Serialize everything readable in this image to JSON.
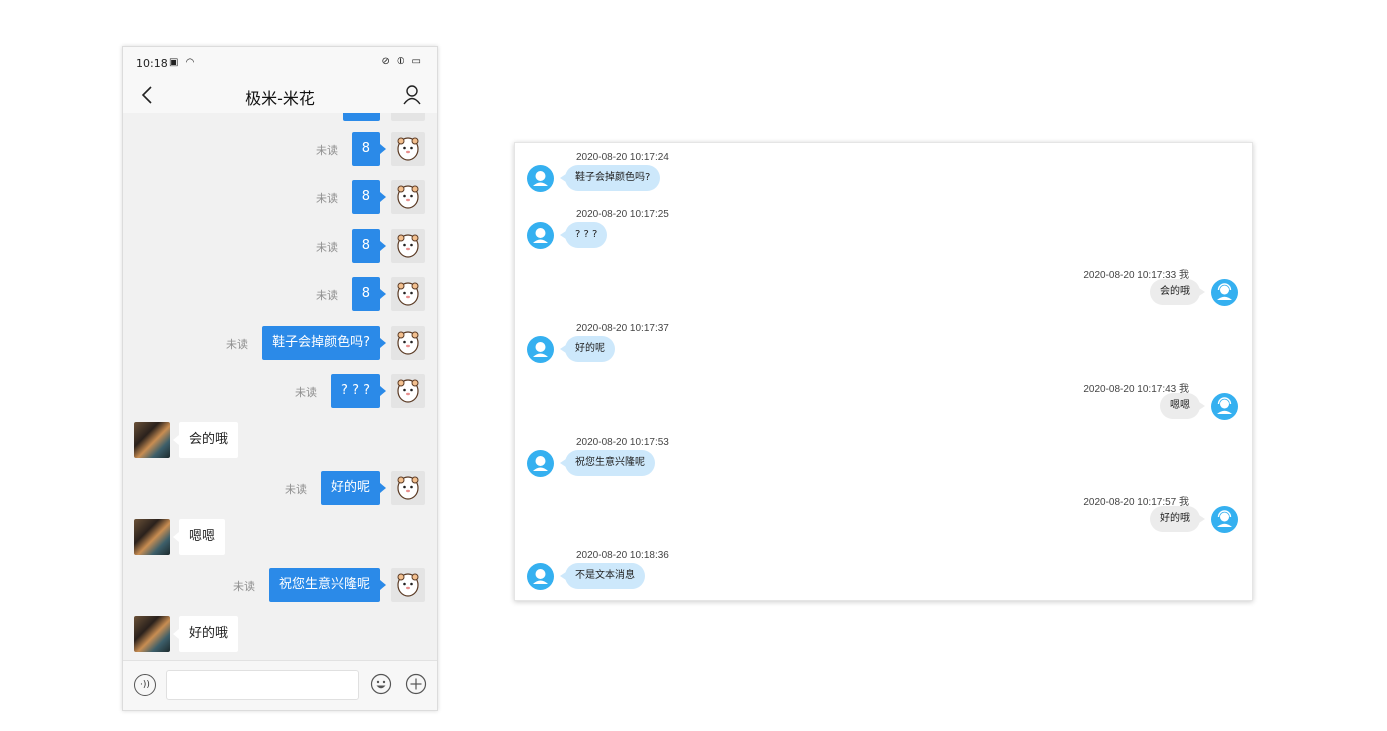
{
  "phone": {
    "status": {
      "time": "10:18",
      "left_icons": "▣ ◠",
      "right_icons": "⊘ ⦶ ▭"
    },
    "nav": {
      "title": "极米-米花"
    },
    "unread_label": "未读",
    "messages": [
      {
        "dir": "out",
        "text": "8",
        "unread": true
      },
      {
        "dir": "out",
        "text": "8",
        "unread": true
      },
      {
        "dir": "out",
        "text": "8",
        "unread": true
      },
      {
        "dir": "out",
        "text": "8",
        "unread": true
      },
      {
        "dir": "out",
        "text": "鞋子会掉颜色吗?",
        "unread": true
      },
      {
        "dir": "out",
        "text": "? ? ?",
        "unread": true
      },
      {
        "dir": "in",
        "text": "会的哦"
      },
      {
        "dir": "out",
        "text": "好的呢",
        "unread": true
      },
      {
        "dir": "in",
        "text": "嗯嗯"
      },
      {
        "dir": "out",
        "text": "祝您生意兴隆呢",
        "unread": true
      },
      {
        "dir": "in",
        "text": "好的哦"
      }
    ],
    "input": {
      "placeholder": ""
    }
  },
  "desktop": {
    "messages": [
      {
        "dir": "in",
        "time": "2020-08-20 10:17:24",
        "text": "鞋子会掉颜色吗?"
      },
      {
        "dir": "in",
        "time": "2020-08-20 10:17:25",
        "text": "? ? ?"
      },
      {
        "dir": "out",
        "time": "2020-08-20 10:17:33 我",
        "text": "会的哦"
      },
      {
        "dir": "in",
        "time": "2020-08-20 10:17:37",
        "text": "好的呢"
      },
      {
        "dir": "out",
        "time": "2020-08-20 10:17:43 我",
        "text": "嗯嗯"
      },
      {
        "dir": "in",
        "time": "2020-08-20 10:17:53",
        "text": "祝您生意兴隆呢"
      },
      {
        "dir": "out",
        "time": "2020-08-20 10:17:57 我",
        "text": "好的哦"
      },
      {
        "dir": "in",
        "time": "2020-08-20 10:18:36",
        "text": "不是文本消息"
      }
    ]
  }
}
